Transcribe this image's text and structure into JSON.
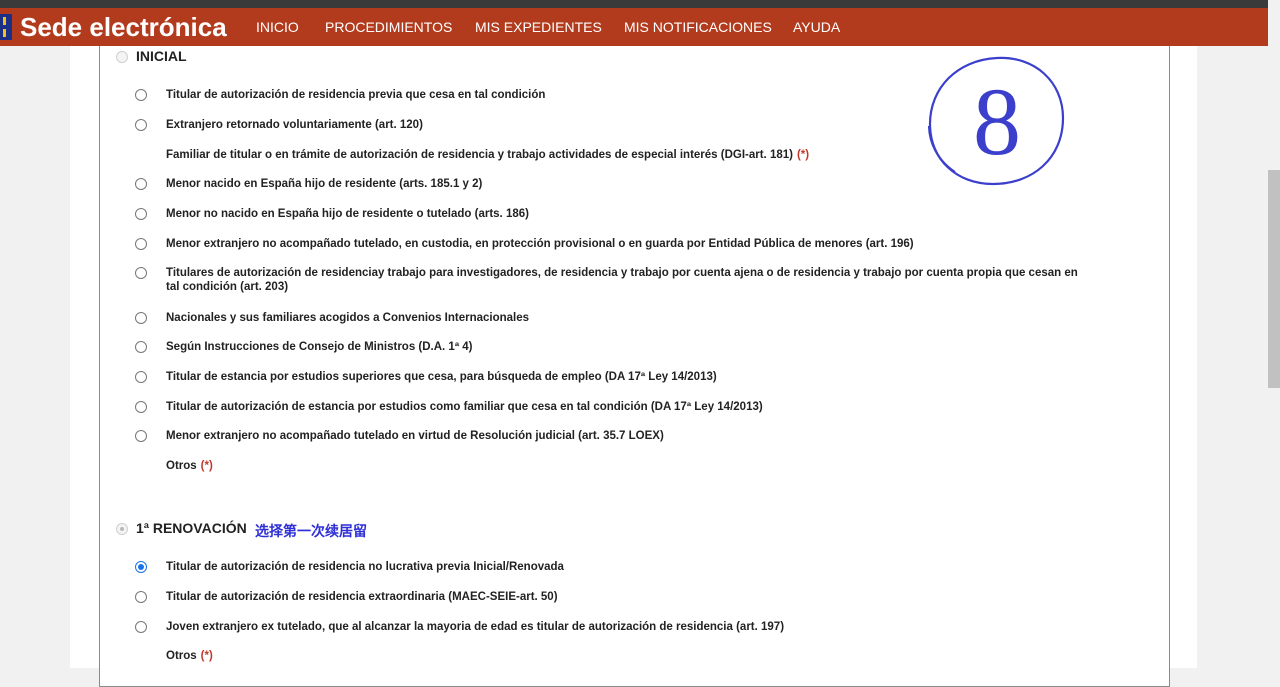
{
  "header": {
    "brand": "Sede electrónica",
    "nav": [
      "INICIO",
      "PROCEDIMIENTOS",
      "MIS EXPEDIENTES",
      "MIS NOTIFICACIONES",
      "AYUDA"
    ]
  },
  "sections": {
    "inicial": {
      "title": "INICIAL",
      "selected": false,
      "options": [
        {
          "label": "Titular de autorización de residencia previa que cesa en tal condición",
          "radio": true,
          "checked": false
        },
        {
          "label": "Extranjero retornado voluntariamente (art. 120)",
          "radio": true,
          "checked": false
        },
        {
          "label": "Familiar de titular o en trámite de autorización de residencia y trabajo actividades de especial interés (DGI-art. 181)",
          "radio": false,
          "required_mark": "(*)"
        },
        {
          "label": "Menor nacido en España hijo de residente (arts. 185.1 y 2)",
          "radio": true,
          "checked": false
        },
        {
          "label": "Menor no nacido en España hijo de residente o tutelado (arts. 186)",
          "radio": true,
          "checked": false
        },
        {
          "label": "Menor extranjero no acompañado tutelado, en custodia, en protección provisional o en guarda por Entidad Pública de menores (art. 196)",
          "radio": true,
          "checked": false
        },
        {
          "label": "Titulares de autorización de residenciay trabajo para investigadores, de residencia y trabajo por cuenta ajena o de residencia y trabajo por cuenta propia que cesan en tal condición (art. 203)",
          "radio": true,
          "checked": false
        },
        {
          "label": "Nacionales y sus familiares acogidos a Convenios Internacionales",
          "radio": true,
          "checked": false
        },
        {
          "label": "Según Instrucciones de Consejo de Ministros (D.A. 1ª 4)",
          "radio": true,
          "checked": false
        },
        {
          "label": "Titular de estancia por estudios superiores que cesa, para búsqueda de empleo (DA 17ª Ley 14/2013)",
          "radio": true,
          "checked": false
        },
        {
          "label": "Titular de autorización de estancia por estudios como familiar que cesa en tal condición (DA 17ª Ley 14/2013)",
          "radio": true,
          "checked": false
        },
        {
          "label": "Menor extranjero no acompañado tutelado en virtud de Resolución judicial (art. 35.7 LOEX)",
          "radio": true,
          "checked": false
        },
        {
          "label": "Otros",
          "radio": false,
          "required_mark": "(*)"
        }
      ]
    },
    "renovacion": {
      "title": "1ª RENOVACIÓN",
      "annotation": "选择第一次续居留",
      "selected": true,
      "options": [
        {
          "label": "Titular de autorización de residencia no lucrativa previa Inicial/Renovada",
          "radio": true,
          "checked": true
        },
        {
          "label": "Titular de autorización de residencia extraordinaria (MAEC-SEIE-art. 50)",
          "radio": true,
          "checked": false
        },
        {
          "label": "Joven extranjero ex tutelado, que al alcanzar la mayoria de edad es titular de autorización de residencia (art. 197)",
          "radio": true,
          "checked": false
        },
        {
          "label": "Otros",
          "radio": false,
          "required_mark": "(*)"
        }
      ]
    }
  },
  "doodle": {
    "text": "8",
    "color": "#3b3fcc"
  },
  "colors": {
    "nav_bg": "#b33b1d",
    "accent": "#1a73e8",
    "required": "#c0392b",
    "annotation": "#2f2fd6"
  }
}
